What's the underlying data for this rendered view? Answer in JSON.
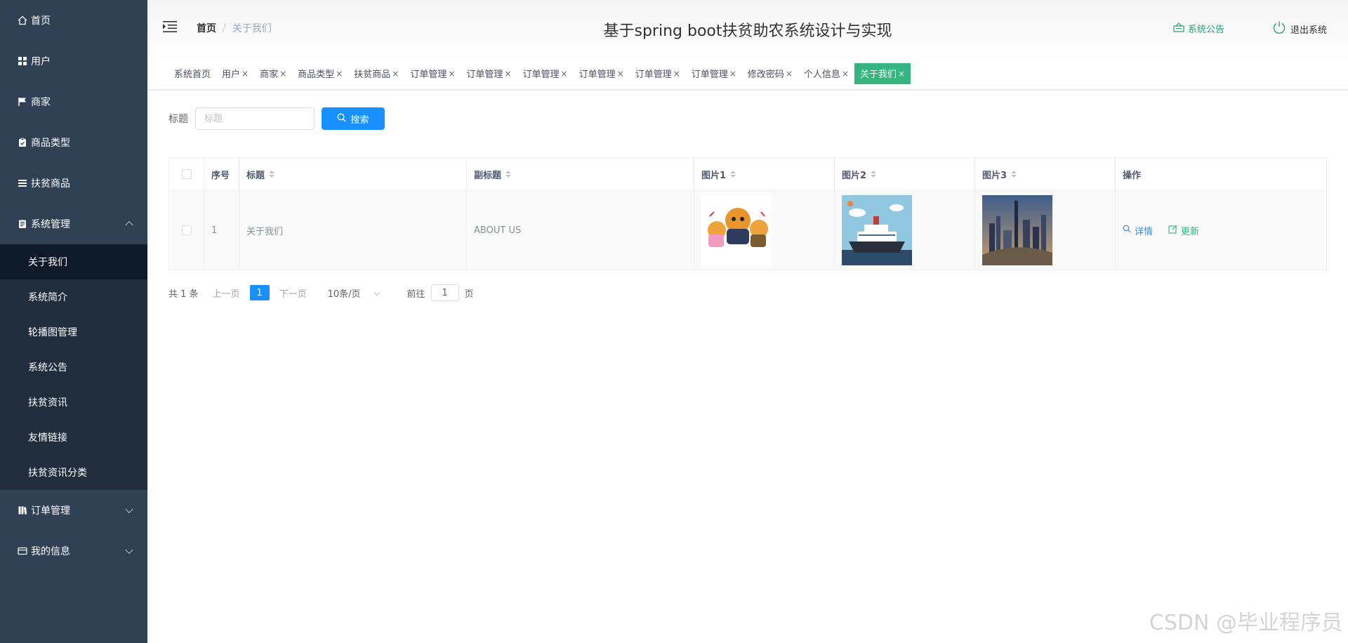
{
  "sidebar": {
    "items": [
      {
        "label": "首页",
        "icon": "home-icon"
      },
      {
        "label": "用户",
        "icon": "grid-icon"
      },
      {
        "label": "商家",
        "icon": "flag-icon"
      },
      {
        "label": "商品类型",
        "icon": "clipboard-icon"
      },
      {
        "label": "扶贫商品",
        "icon": "list-icon"
      },
      {
        "label": "系统管理",
        "icon": "doc-icon"
      }
    ],
    "submenu": [
      "关于我们",
      "系统简介",
      "轮播图管理",
      "系统公告",
      "扶贫资讯",
      "友情链接",
      "扶贫资讯分类"
    ],
    "bottom": [
      {
        "label": "订单管理",
        "icon": "book-icon"
      },
      {
        "label": "我的信息",
        "icon": "card-icon"
      }
    ]
  },
  "header": {
    "breadcrumb_home": "首页",
    "breadcrumb_sep": "/",
    "breadcrumb_current": "关于我们",
    "title": "基于spring boot扶贫助农系统设计与实现",
    "notice": "系统公告",
    "logout": "退出系统"
  },
  "tags": [
    "系统首页",
    "用户",
    "商家",
    "商品类型",
    "扶贫商品",
    "订单管理",
    "订单管理",
    "订单管理",
    "订单管理",
    "订单管理",
    "订单管理",
    "修改密码",
    "个人信息",
    "关于我们"
  ],
  "tag_close": "×",
  "search": {
    "label": "标题",
    "placeholder": "标题",
    "button": "搜索"
  },
  "table": {
    "headers": [
      "序号",
      "标题",
      "副标题",
      "图片1",
      "图片2",
      "图片3",
      "操作"
    ],
    "rows": [
      {
        "index": "1",
        "title": "关于我们",
        "subtitle": "ABOUT US"
      }
    ],
    "actions": {
      "detail": "详情",
      "update": "更新"
    }
  },
  "pager": {
    "total": "共 1 条",
    "prev": "上一页",
    "page": "1",
    "next": "下一页",
    "size": "10条/页",
    "goto_prefix": "前往",
    "goto_value": "1",
    "goto_suffix": "页"
  },
  "watermark": "CSDN @毕业程序员",
  "colors": {
    "sidebar": "#304156",
    "accent": "#35b580",
    "primary": "#1890ff"
  }
}
